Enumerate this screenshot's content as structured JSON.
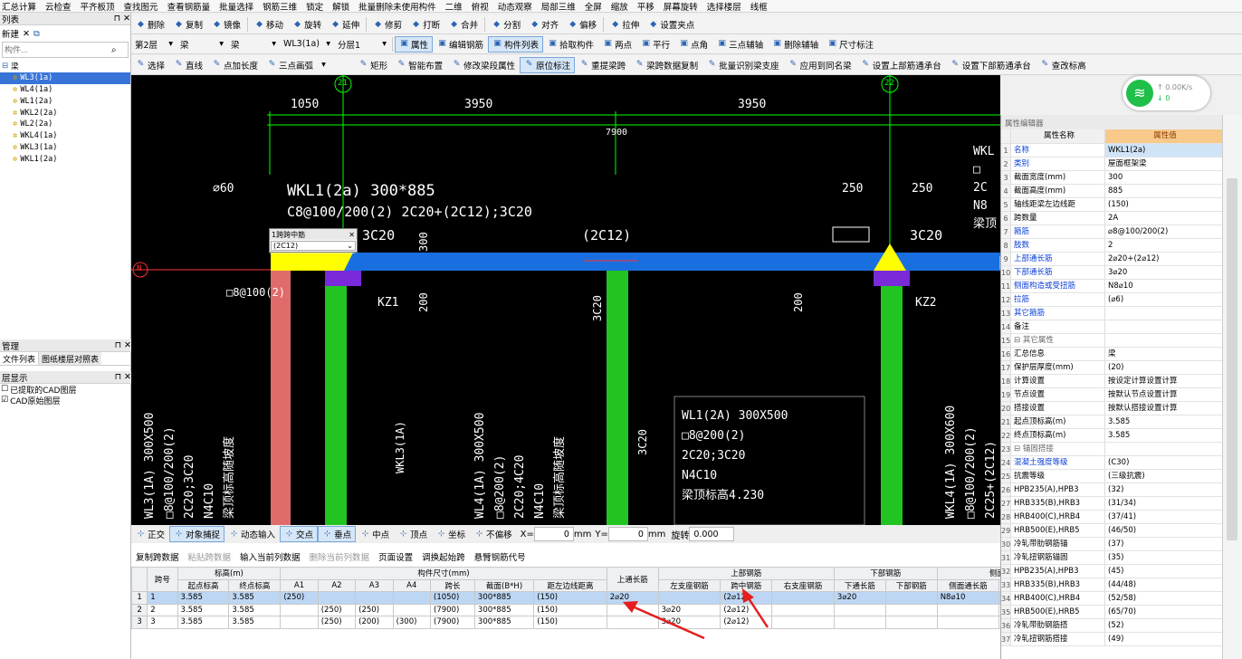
{
  "menubar": [
    "汇总计算",
    "云检查",
    "平齐板顶",
    "查找图元",
    "查看钢筋量",
    "批量选择",
    "钢筋三维",
    "锁定",
    "解锁",
    "批量删除未使用构件",
    "二维",
    "俯视",
    "动态观察",
    "局部三维",
    "全屏",
    "缩放",
    "平移",
    "屏幕旋转",
    "选择楼层",
    "线框"
  ],
  "toolbar1": [
    "删除",
    "复制",
    "镜像",
    "移动",
    "旋转",
    "延伸",
    "修剪",
    "打断",
    "合并",
    "分割",
    "对齐",
    "偏移",
    "拉伸",
    "设置夹点"
  ],
  "toolbar2": {
    "floor": "第2层",
    "type1": "梁",
    "type2": "梁",
    "component": "WL3(1a)",
    "layer": "分层1",
    "buttons": [
      "属性",
      "编辑钢筋",
      "构件列表",
      "拾取构件",
      "两点",
      "平行",
      "点角",
      "三点辅轴",
      "删除辅轴",
      "尺寸标注"
    ]
  },
  "toolbar3": [
    "选择",
    "直线",
    "点加长度",
    "三点画弧",
    "",
    "矩形",
    "智能布置",
    "修改梁段属性",
    "原位标注",
    "重提梁跨",
    "梁跨数据复制",
    "批量识别梁支座",
    "应用到同名梁",
    "设置上部筋通承台",
    "设置下部筋通承台",
    "查改标高"
  ],
  "left": {
    "list_title": "列表",
    "new_label": "新建",
    "search_placeholder": "构件...",
    "root": "梁",
    "items": [
      "WL3(1a)",
      "WL4(1a)",
      "WL1(2a)",
      "WKL2(2a)",
      "WL2(2a)",
      "WKL4(1a)",
      "WKL3(1a)",
      "WKL1(2a)"
    ],
    "mgr_title": "管理",
    "tab1": "文件列表",
    "tab2": "图纸楼层对照表",
    "layer_title": "层显示",
    "layer1": "已提取的CAD图层",
    "layer2": "CAD原始图层"
  },
  "cad": {
    "dims_top": [
      "1050",
      "3950",
      "3950",
      "7900"
    ],
    "axis": [
      "21",
      "22",
      "N"
    ],
    "beam1": [
      "WKL1(2a) 300*885",
      "C8@100/200(2) 2C20+(2C12);3C20",
      "(2C12)"
    ],
    "popup_title": "1跨跨中筋",
    "popup_value": "(2C12)",
    "labels_small": [
      "250",
      "250",
      "300",
      "200",
      "200",
      "3C20",
      "3C20",
      "3C20",
      "KZ1",
      "KZ2",
      "□8@100(2)"
    ],
    "wl1": [
      "WL1(2A) 300X500",
      "□8@200(2)",
      "2C20;3C20",
      "N4C10",
      "梁顶标高4.230"
    ],
    "vert_left": [
      "WL3(1A) 300X500",
      "□8@100/200(2)",
      "2C20;3C20",
      "N4C10",
      "梁顶标高随坡度"
    ],
    "vert_mid": [
      "WKL3(1A)",
      "WL4(1A) 300X500",
      "□8@200(2)",
      "2C20;4C20",
      "N4C10",
      "梁顶标高随坡度"
    ],
    "vert_right": [
      "3C20",
      "3C20",
      "WKL4(1A) 300X600",
      "□8@100/200(2)",
      "2C25+(2C12)"
    ],
    "top_right": [
      "WKL",
      "□",
      "2C",
      "N8",
      "梁顶"
    ]
  },
  "snapbar": {
    "items": [
      "正交",
      "对象捕捉",
      "动态输入",
      "交点",
      "垂点",
      "中点",
      "顶点",
      "坐标",
      "不偏移"
    ],
    "x_label": "X=",
    "x_val": "0",
    "y_label": "Y=",
    "y_val": "0",
    "unit": "mm",
    "rotate_label": "旋转",
    "rotate_val": "0.000"
  },
  "bottombar": [
    "复制跨数据",
    "粘贴跨数据",
    "输入当前列数据",
    "删除当前列数据",
    "页面设置",
    "调换起始跨",
    "悬臂钢筋代号"
  ],
  "table": {
    "h1": [
      "跨号",
      "标高(m)",
      "构件尺寸(mm)",
      "上通长筋",
      "上部钢筋",
      "下部钢筋",
      "侧面钢筋"
    ],
    "h2": [
      "起点标高",
      "终点标高",
      "A1",
      "A2",
      "A3",
      "A4",
      "跨长",
      "截面(B*H)",
      "距左边线距离",
      "左支座钢筋",
      "跨中钢筋",
      "右支座钢筋",
      "下通长筋",
      "下部钢筋",
      "侧面通长筋",
      "侧面原位标注"
    ],
    "rows": [
      [
        "1",
        "1",
        "3.585",
        "3.585",
        "(250)",
        "",
        "",
        "",
        "(1050)",
        "300*885",
        "(150)",
        "2⌀20",
        "",
        "(2⌀12)",
        "",
        "3⌀20",
        "",
        "N8⌀10",
        ""
      ],
      [
        "2",
        "2",
        "3.585",
        "3.585",
        "",
        "(250)",
        "(250)",
        "",
        "(7900)",
        "300*885",
        "(150)",
        "",
        "3⌀20",
        "(2⌀12)",
        "",
        "",
        "",
        "",
        ""
      ],
      [
        "3",
        "3",
        "3.585",
        "3.585",
        "",
        "(250)",
        "(200)",
        "(300)",
        "(7900)",
        "300*885",
        "(150)",
        "",
        "3⌀20",
        "(2⌀12)",
        "",
        "",
        "",
        "",
        ""
      ]
    ]
  },
  "props": {
    "title": "属性编辑器",
    "col1": "属性名称",
    "col2": "属性值",
    "rows": [
      [
        "1",
        "名称",
        "WKL1(2a)",
        "blue"
      ],
      [
        "2",
        "类别",
        "屋面框架梁",
        "blue"
      ],
      [
        "3",
        "截面宽度(mm)",
        "300",
        ""
      ],
      [
        "4",
        "截面高度(mm)",
        "885",
        ""
      ],
      [
        "5",
        "轴线距梁左边线距",
        "(150)",
        ""
      ],
      [
        "6",
        "跨数量",
        "2A",
        ""
      ],
      [
        "7",
        "箍筋",
        "⌀8@100/200(2)",
        "blue"
      ],
      [
        "8",
        "肢数",
        "2",
        "blue"
      ],
      [
        "9",
        "上部通长筋",
        "2⌀20+(2⌀12)",
        "blue"
      ],
      [
        "10",
        "下部通长筋",
        "3⌀20",
        "blue"
      ],
      [
        "11",
        "侧面构造或受扭筋",
        "N8⌀10",
        "blue"
      ],
      [
        "12",
        "拉筋",
        "(⌀6)",
        "blue"
      ],
      [
        "13",
        "其它箍筋",
        "",
        "blue"
      ],
      [
        "14",
        "备注",
        "",
        ""
      ],
      [
        "15",
        "⊟ 其它属性",
        "",
        "grp"
      ],
      [
        "16",
        "汇总信息",
        "梁",
        ""
      ],
      [
        "17",
        "保护层厚度(mm)",
        "(20)",
        ""
      ],
      [
        "18",
        "计算设置",
        "按设定计算设置计算",
        ""
      ],
      [
        "19",
        "节点设置",
        "按默认节点设置计算",
        ""
      ],
      [
        "20",
        "搭接设置",
        "按默认搭接设置计算",
        ""
      ],
      [
        "21",
        "起点顶标高(m)",
        "3.585",
        ""
      ],
      [
        "22",
        "终点顶标高(m)",
        "3.585",
        ""
      ],
      [
        "23",
        "⊟ 锚固搭接",
        "",
        "grp"
      ],
      [
        "24",
        "混凝土强度等级",
        "(C30)",
        "blue"
      ],
      [
        "25",
        "抗震等级",
        "(三级抗震)",
        ""
      ],
      [
        "26",
        "HPB235(A),HPB3",
        "(32)",
        ""
      ],
      [
        "27",
        "HRB335(B),HRB3",
        "(31/34)",
        ""
      ],
      [
        "28",
        "HRB400(C),HRB4",
        "(37/41)",
        ""
      ],
      [
        "29",
        "HRB500(E),HRB5",
        "(46/50)",
        ""
      ],
      [
        "30",
        "冷轧带肋钢筋锚",
        "(37)",
        ""
      ],
      [
        "31",
        "冷轧扭钢筋锚固",
        "(35)",
        ""
      ],
      [
        "32",
        "HPB235(A),HPB3",
        "(45)",
        ""
      ],
      [
        "33",
        "HRB335(B),HRB3",
        "(44/48)",
        ""
      ],
      [
        "34",
        "HRB400(C),HRB4",
        "(52/58)",
        ""
      ],
      [
        "35",
        "HRB500(E),HRB5",
        "(65/70)",
        ""
      ],
      [
        "36",
        "冷轧带肋钢筋搭",
        "(52)",
        ""
      ],
      [
        "37",
        "冷轧扭钢筋搭接",
        "(49)",
        ""
      ]
    ]
  },
  "net": {
    "up": "0.00K/s",
    "down": "0"
  }
}
